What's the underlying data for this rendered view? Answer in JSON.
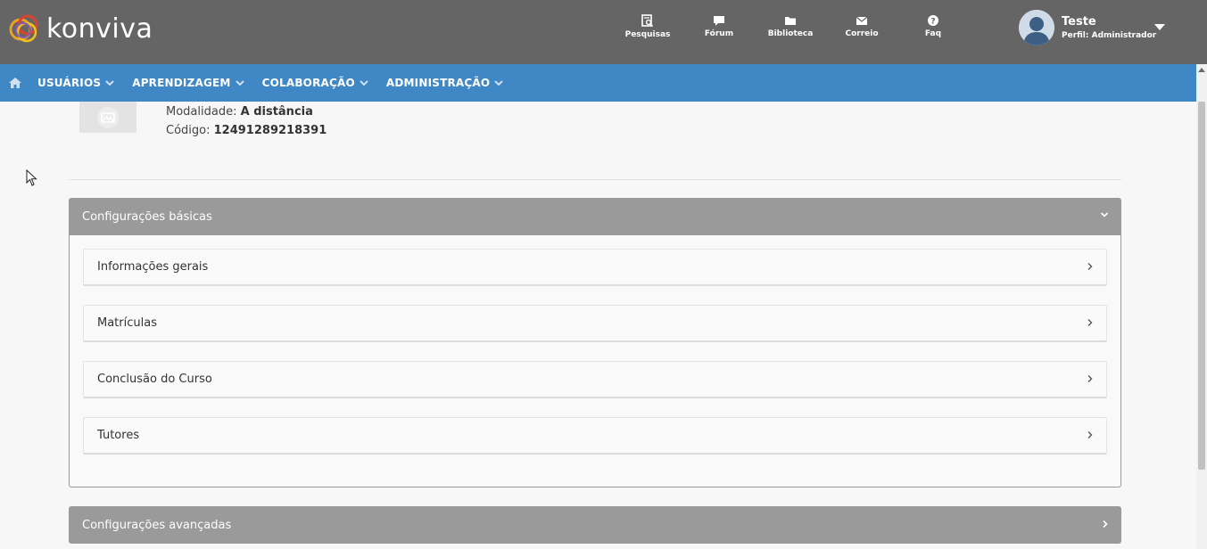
{
  "brand": {
    "name": "konviva"
  },
  "topnav": [
    {
      "label": "Pesquisas",
      "icon": "survey-icon"
    },
    {
      "label": "Fórum",
      "icon": "forum-icon"
    },
    {
      "label": "Biblioteca",
      "icon": "folder-icon"
    },
    {
      "label": "Correio",
      "icon": "mail-icon"
    },
    {
      "label": "Faq",
      "icon": "help-icon"
    }
  ],
  "user": {
    "name": "Teste",
    "role": "Perfil: Administrador"
  },
  "mainnav": [
    {
      "label": "USUÁRIOS"
    },
    {
      "label": "APRENDIZAGEM"
    },
    {
      "label": "COLABORAÇÃO"
    },
    {
      "label": "ADMINISTRAÇÃO"
    }
  ],
  "course": {
    "modality_label": "Modalidade:",
    "modality_value": "A distância",
    "code_label": "Código:",
    "code_value": "12491289218391"
  },
  "panels": {
    "basic": {
      "title": "Configurações básicas",
      "items": [
        {
          "label": "Informações gerais"
        },
        {
          "label": "Matrículas"
        },
        {
          "label": "Conclusão do Curso"
        },
        {
          "label": "Tutores"
        }
      ]
    },
    "advanced": {
      "title": "Configurações avançadas"
    }
  },
  "colors": {
    "topbar": "#656565",
    "mainnav": "#3f88c5",
    "panel_header": "#9a9a9a"
  }
}
